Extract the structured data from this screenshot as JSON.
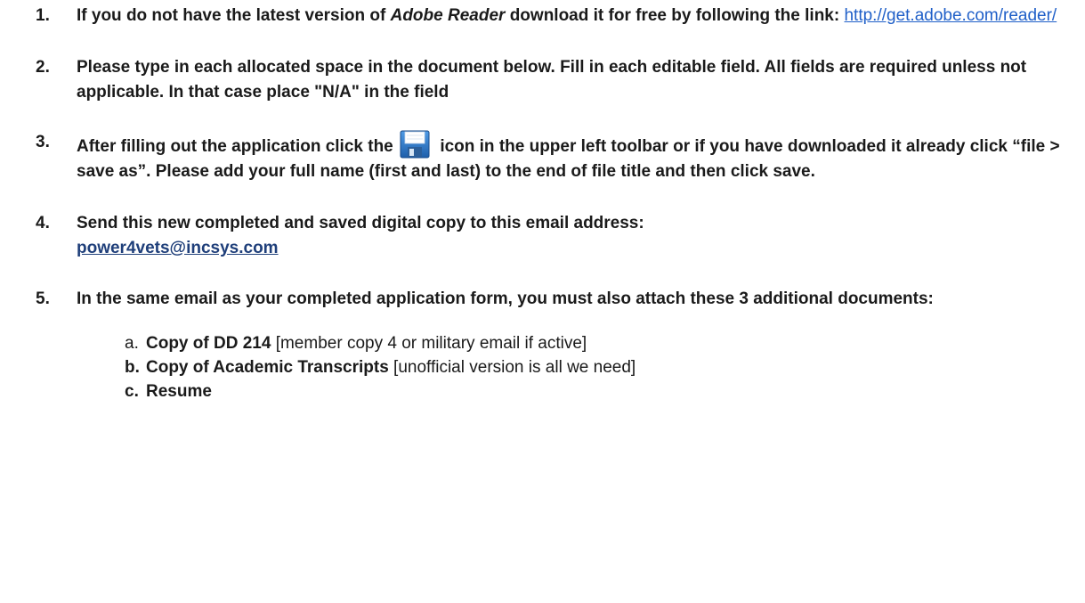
{
  "steps": {
    "s1": {
      "num": "1.",
      "text_a": "If you do not have the latest version of ",
      "text_em": "Adobe Reader",
      "text_b": " download it for free by following the link: ",
      "link": "http://get.adobe.com/reader/"
    },
    "s2": {
      "num": "2.",
      "text": "Please type in each allocated space in the document below. Fill in each editable field.  All fields are required unless not applicable. In that case place \"N/A\" in the field"
    },
    "s3": {
      "num": "3.",
      "text_a": "After filling out the application click the",
      "icon": "save-icon",
      "text_b": "icon in the upper left toolbar or if you have downloaded it already click “file > save as”.  Please add your full name (first and last) to the end of file title and then click save."
    },
    "s4": {
      "num": "4.",
      "text": "Send this new completed and saved digital copy to this email address:",
      "email": "power4vets@incsys.com"
    },
    "s5": {
      "num": "5.",
      "text": "In the same email as your completed application form, you must also attach these 3 additional documents:"
    }
  },
  "attachments": [
    {
      "letter": "a.",
      "title": "Copy of DD 214",
      "note": " [member copy 4 or military email if active]"
    },
    {
      "letter": "b.",
      "title": "Copy of Academic Transcripts",
      "note": " [unofficial version is all we need]"
    },
    {
      "letter": "c.",
      "title": "Resume",
      "note": ""
    }
  ],
  "colors": {
    "link": "#1f5fc8",
    "email": "#1f3f7a",
    "icon_blue": "#2a6fc0"
  }
}
